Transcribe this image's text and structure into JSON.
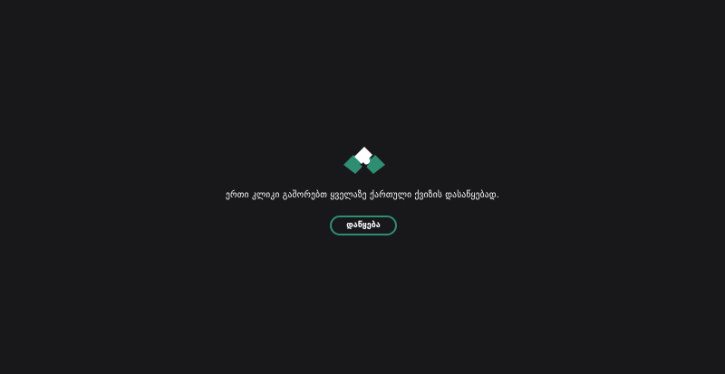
{
  "colors": {
    "background": "#18171a",
    "accent": "#2f8e72",
    "text": "#ffffff"
  },
  "logo": {
    "icon": "puzzle-pieces-logo-icon"
  },
  "message": "ერთი კლიკი გაშორებთ ყველაზე ქართული ქვიზის დასაწყებად.",
  "start_button": {
    "label": "დაწყება"
  }
}
